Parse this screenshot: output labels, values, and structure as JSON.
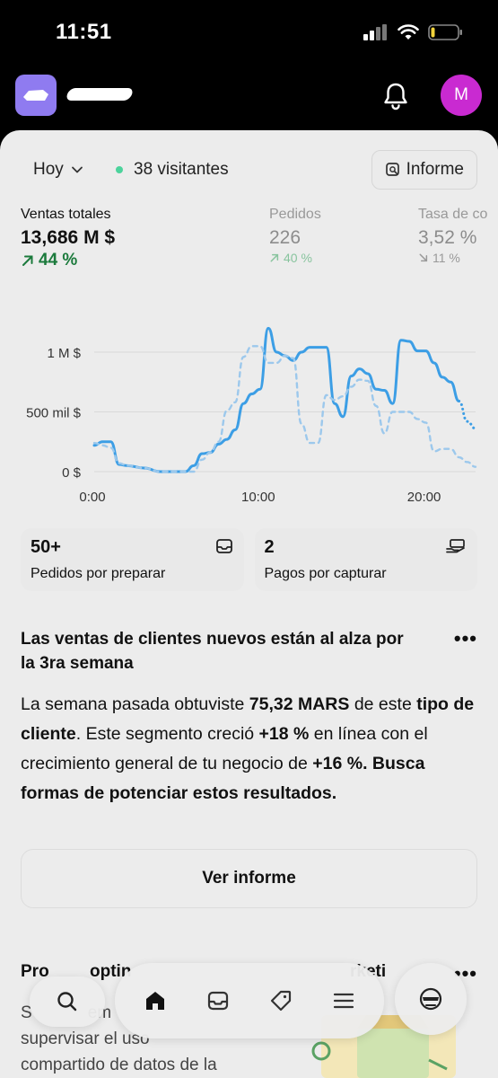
{
  "status_bar": {
    "time": "11:51"
  },
  "header": {
    "avatar_initial": "M"
  },
  "filters": {
    "date_range": "Hoy",
    "visitors": "38 visitantes",
    "report_button": "Informe"
  },
  "metrics": [
    {
      "label": "Ventas totales",
      "value": "13,686 M $",
      "delta": "44 %"
    },
    {
      "label": "Pedidos",
      "value": "226",
      "delta": "40 %"
    },
    {
      "label": "Tasa de co",
      "value": "3,52 %",
      "delta": "11 %"
    }
  ],
  "chart_data": {
    "type": "line",
    "y_tick_labels": [
      "1 M $",
      "500 mil $",
      "0 $"
    ],
    "x_tick_labels": [
      "0:00",
      "10:00",
      "20:00"
    ],
    "ylim": [
      0,
      1200000
    ],
    "xlim": [
      0,
      23
    ],
    "grid": true,
    "series": [
      {
        "style": "solid",
        "color": "#3c9ee5",
        "x": [
          0,
          0.5,
          1,
          1.5,
          2,
          3,
          4,
          5,
          5.5,
          6,
          6.5,
          7,
          7.5,
          8,
          8.5,
          9,
          9.5,
          10,
          10.5,
          11,
          11.5,
          12,
          12.5,
          13,
          13.5,
          14,
          14.5,
          15,
          15.5,
          16,
          16.5,
          17,
          17.5,
          18,
          18.5,
          19,
          19.5,
          20,
          20.5,
          21,
          21.5,
          22
        ],
        "y": [
          220000,
          250000,
          250000,
          60000,
          50000,
          30000,
          0,
          0,
          0,
          50000,
          150000,
          160000,
          230000,
          270000,
          350000,
          570000,
          650000,
          690000,
          1200000,
          1000000,
          970000,
          930000,
          1000000,
          1040000,
          1040000,
          1040000,
          570000,
          460000,
          800000,
          860000,
          820000,
          690000,
          680000,
          570000,
          1100000,
          1090000,
          1010000,
          1010000,
          910000,
          790000,
          750000,
          590000
        ]
      },
      {
        "style": "dotted",
        "color": "#3c9ee5",
        "x": [
          22,
          22.5,
          23
        ],
        "y": [
          590000,
          420000,
          360000
        ]
      },
      {
        "style": "dashed",
        "color": "#9cc8ec",
        "x": [
          0,
          0.5,
          1,
          1.5,
          2,
          3,
          4,
          5,
          5.5,
          6,
          6.5,
          7,
          7.5,
          8,
          8.5,
          9,
          9.5,
          10,
          10.5,
          11,
          11.5,
          12,
          12.5,
          13,
          13.5,
          14,
          14.5,
          15,
          15.5,
          16,
          16.5,
          17,
          17.5,
          18,
          18.5,
          19,
          19.5,
          20,
          20.5,
          21,
          21.5,
          22,
          22.5,
          23
        ],
        "y": [
          240000,
          220000,
          200000,
          70000,
          50000,
          30000,
          0,
          0,
          0,
          0,
          100000,
          160000,
          250000,
          510000,
          580000,
          960000,
          1050000,
          1050000,
          910000,
          910000,
          970000,
          950000,
          400000,
          240000,
          240000,
          640000,
          600000,
          630000,
          710000,
          770000,
          760000,
          550000,
          320000,
          500000,
          500000,
          500000,
          440000,
          410000,
          170000,
          190000,
          190000,
          120000,
          80000,
          40000
        ]
      }
    ]
  },
  "tiles": [
    {
      "value": "50+",
      "label": "Pedidos por preparar"
    },
    {
      "value": "2",
      "label": "Pagos por capturar"
    }
  ],
  "insight": {
    "title": "Las ventas de clientes nuevos están al alza por la 3ra semana",
    "body_1": "La semana pasada obtuviste ",
    "body_2": "75,32 MARS",
    "body_3": " de este ",
    "body_4": "tipo de cliente",
    "body_5": ". Este segmento creció ",
    "body_6": "+18 %",
    "body_7": " en línea con el crecimiento general de tu negocio de ",
    "body_8": "+16 %",
    "body_9": ". ",
    "body_10": "Busca formas de potenciar estos resultados.",
    "button": "Ver informe"
  },
  "next_card": {
    "title_left": "Pro",
    "title_mid": "optin",
    "title_right": "rketi",
    "body_line1": "S",
    "body_line1b": "em",
    "body_line2": "supervisar el uso",
    "body_line3": "compartido de datos de la"
  },
  "nav": [
    "search",
    "home",
    "orders",
    "products",
    "menu",
    "agent"
  ]
}
